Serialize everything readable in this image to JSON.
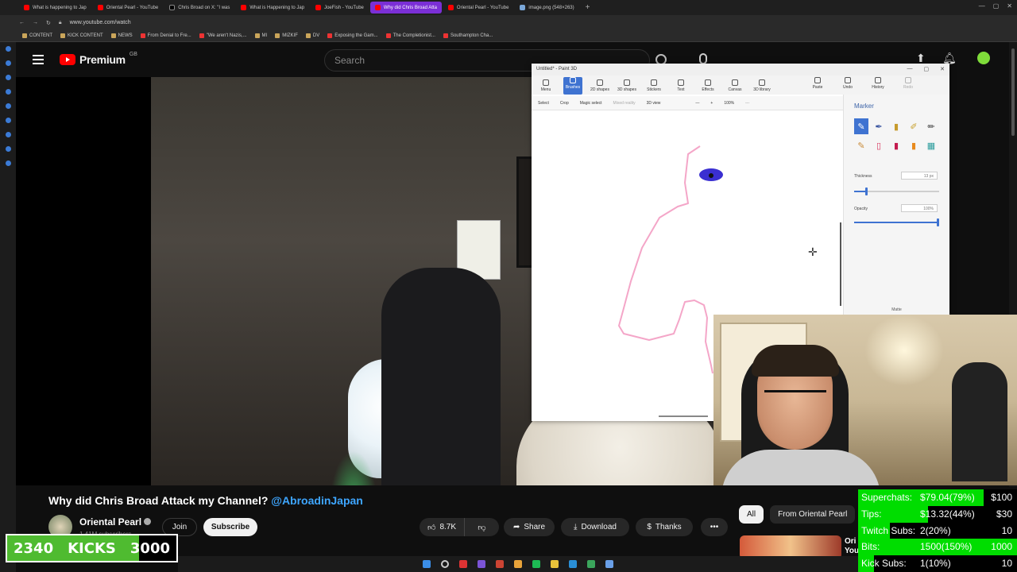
{
  "browser": {
    "tabs": [
      {
        "label": "What is happening to Jap",
        "fav": "youtube"
      },
      {
        "label": "Oriental Pearl - YouTube",
        "fav": "youtube"
      },
      {
        "label": "Chris Broad on X: \"I was",
        "fav": "x"
      },
      {
        "label": "What is Happening to Jap",
        "fav": "youtube"
      },
      {
        "label": "JoeFish - YouTube",
        "fav": "youtube"
      },
      {
        "label": "Why did Chris Broad Atta",
        "fav": "youtube",
        "active": true
      },
      {
        "label": "Oriental Pearl - YouTube",
        "fav": "youtube"
      },
      {
        "label": "image.png (548×263)",
        "fav": "image"
      }
    ],
    "url": "www.youtube.com/watch",
    "bookmarks": [
      {
        "label": "CONTENT",
        "kind": "folder"
      },
      {
        "label": "KICK CONTENT",
        "kind": "folder"
      },
      {
        "label": "NEWS",
        "kind": "folder"
      },
      {
        "label": "From Denial to Fre...",
        "kind": "youtube"
      },
      {
        "label": "\"We aren't Nazis,...",
        "kind": "youtube"
      },
      {
        "label": "MI",
        "kind": "folder"
      },
      {
        "label": "MIZKIF",
        "kind": "folder"
      },
      {
        "label": "DV",
        "kind": "folder"
      },
      {
        "label": "Exposing the Gam...",
        "kind": "youtube"
      },
      {
        "label": "The Completionist...",
        "kind": "youtube"
      },
      {
        "label": "Southampton Cha...",
        "kind": "youtube"
      }
    ]
  },
  "youtube": {
    "logo_text": "Premium",
    "region": "GB",
    "search_placeholder": "Search",
    "video_title": "Why did Chris Broad Attack my Channel?",
    "video_title_tag": "@AbroadinJapan",
    "channel_name": "Oriental Pearl",
    "subscribers": "1.41M subscribers",
    "join_label": "Join",
    "subscribe_label": "Subscribe",
    "likes": "8.7K",
    "share_label": "Share",
    "download_label": "Download",
    "thanks_label": "Thanks",
    "chips": [
      "All",
      "From Oriental Pearl"
    ],
    "rec_text": "Ori\nYou"
  },
  "paint3d": {
    "title": "Untitled* - Paint 3D",
    "ribbon": [
      "Menu",
      "Brushes",
      "2D shapes",
      "3D shapes",
      "Stickers",
      "Text",
      "Effects",
      "Canvas",
      "3D library"
    ],
    "ribbon_right": [
      "Paste",
      "Undo",
      "History",
      "Redo"
    ],
    "tools": [
      "Select",
      "Crop",
      "Magic select",
      "Mixed reality",
      "3D view"
    ],
    "zoom": "100%",
    "panel_title": "Marker",
    "thickness_label": "Thickness",
    "thickness_value": "13 px",
    "thickness_level": 0.13,
    "opacity_label": "Opacity",
    "opacity_value": "100%",
    "opacity_level": 1.0,
    "finish": "Matte",
    "brushes": [
      "marker",
      "calligraphy-pen",
      "oil-brush",
      "watercolor",
      "pixel-pen",
      "pencil",
      "eraser",
      "crayon",
      "spraycan",
      "fill"
    ],
    "colors": {
      "accent": "#3f73d1",
      "stroke_pink": "#f4a6c8",
      "blob_blue": "#3a2fd1"
    }
  },
  "overlay": {
    "kicks_current": "2340",
    "kicks_label": "KICKS",
    "kicks_goal": "3000",
    "kicks_fraction": 0.78,
    "stats": [
      {
        "label": "Superchats:",
        "value": "$79.04(79%)",
        "target": "$100",
        "fraction": 0.79
      },
      {
        "label": "Tips:",
        "value": "$13.32(44%)",
        "target": "$30",
        "fraction": 0.44
      },
      {
        "label": "Twitch Subs:",
        "value": "2(20%)",
        "target": "10",
        "fraction": 0.2
      },
      {
        "label": "Bits:",
        "value": "1500(150%)",
        "target": "1000",
        "fraction": 1.0
      },
      {
        "label": "Kick Subs:",
        "value": "1(10%)",
        "target": "10",
        "fraction": 0.1
      }
    ]
  }
}
